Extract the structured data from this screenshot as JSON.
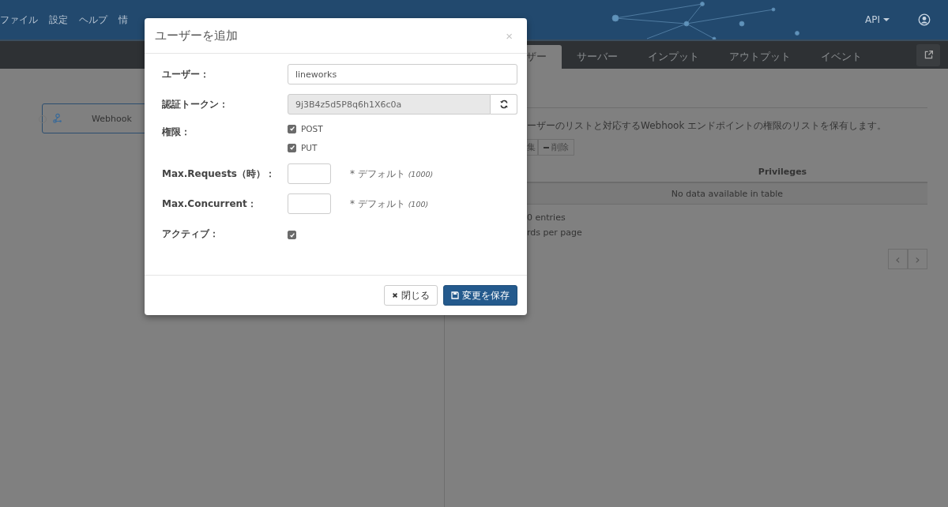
{
  "menu": [
    "ファイル",
    "設定",
    "ヘルプ",
    "情"
  ],
  "header_right": {
    "api_menu": "API"
  },
  "canvas": {
    "nodes": [
      {
        "label": "Webhook",
        "selected": true
      }
    ]
  },
  "tabs": [
    {
      "label": "ザー",
      "selected": true
    },
    {
      "label": "サーバー",
      "selected": false
    },
    {
      "label": "インプット",
      "selected": false
    },
    {
      "label": "アウトプット",
      "selected": false
    },
    {
      "label": "イベント",
      "selected": false
    }
  ],
  "panel": {
    "description": "ーザーのリストと対応するWebhook エンドポイントの権限のリストを保有します。",
    "buttons": [
      "集",
      "削除"
    ],
    "table": {
      "columns": [
        "Privileges"
      ],
      "empty_text": "No data available in table"
    },
    "info": "0 entries",
    "length_text": "rds per page",
    "pagination": [
      "‹",
      "›"
    ]
  },
  "dialog": {
    "title": "ユーザーを追加",
    "close": "×",
    "fields": [
      {
        "kind": "text",
        "label": "ユーザー：",
        "value": "lineworks"
      },
      {
        "kind": "token",
        "label": "認証トークン：",
        "value": "9j3B4z5d5P8q6h1X6c0a"
      },
      {
        "kind": "checks",
        "label": "権限：",
        "options": [
          {
            "label": "POST",
            "checked": true
          },
          {
            "label": "PUT",
            "checked": true
          }
        ]
      },
      {
        "kind": "number",
        "label": "Max.Requests（時）：",
        "hint": "* デフォルト",
        "hint_default": "(1000)"
      },
      {
        "kind": "number",
        "label": "Max.Concurrent：",
        "hint": "* デフォルト",
        "hint_default": "(100)"
      },
      {
        "kind": "check",
        "label": "アクティブ：",
        "checked": true
      }
    ],
    "buttons": [
      {
        "kind": "close",
        "label": "閉じる"
      },
      {
        "kind": "save",
        "label": "変更を保存"
      }
    ]
  }
}
